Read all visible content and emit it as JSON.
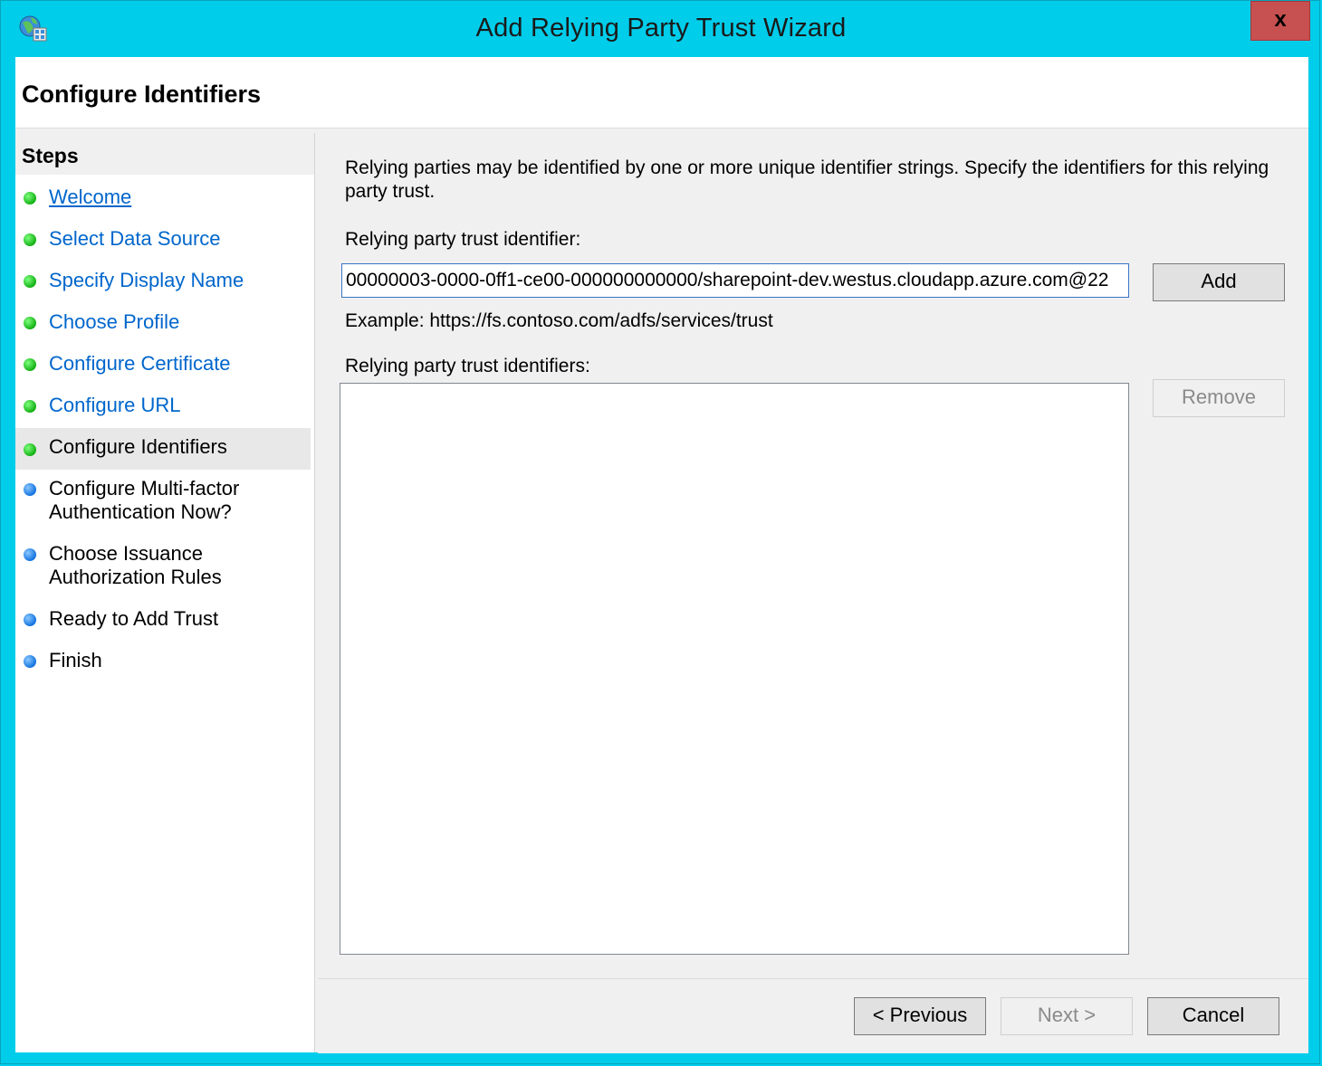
{
  "window": {
    "title": "Add Relying Party Trust Wizard",
    "close_label": "x"
  },
  "header": {
    "title": "Configure Identifiers"
  },
  "steps": {
    "heading": "Steps",
    "items": [
      {
        "label": "Welcome",
        "state": "done"
      },
      {
        "label": "Select Data Source",
        "state": "done"
      },
      {
        "label": "Specify Display Name",
        "state": "done"
      },
      {
        "label": "Choose Profile",
        "state": "done"
      },
      {
        "label": "Configure Certificate",
        "state": "done"
      },
      {
        "label": "Configure URL",
        "state": "done"
      },
      {
        "label": "Configure Identifiers",
        "state": "current"
      },
      {
        "label_line1": "Configure Multi-factor",
        "label_line2": "Authentication Now?",
        "state": "pending"
      },
      {
        "label_line1": "Choose Issuance",
        "label_line2": "Authorization Rules",
        "state": "pending"
      },
      {
        "label": "Ready to Add Trust",
        "state": "pending"
      },
      {
        "label": "Finish",
        "state": "pending"
      }
    ]
  },
  "content": {
    "description": "Relying parties may be identified by one or more unique identifier strings. Specify the identifiers for this relying party trust.",
    "identifier_label": "Relying party trust identifier:",
    "identifier_value": "00000003-0000-0ff1-ce00-000000000000/sharepoint-dev.westus.cloudapp.azure.com@22",
    "add_label": "Add",
    "example_text": "Example: https://fs.contoso.com/adfs/services/trust",
    "identifiers_label": "Relying party trust identifiers:",
    "remove_label": "Remove"
  },
  "footer": {
    "previous_label": "< Previous",
    "next_label": "Next >",
    "cancel_label": "Cancel"
  },
  "colors": {
    "titlebar": "#00cdea",
    "close": "#c75050",
    "step_done": "#14b014",
    "step_pending": "#1473e0",
    "link": "#0066cc"
  }
}
